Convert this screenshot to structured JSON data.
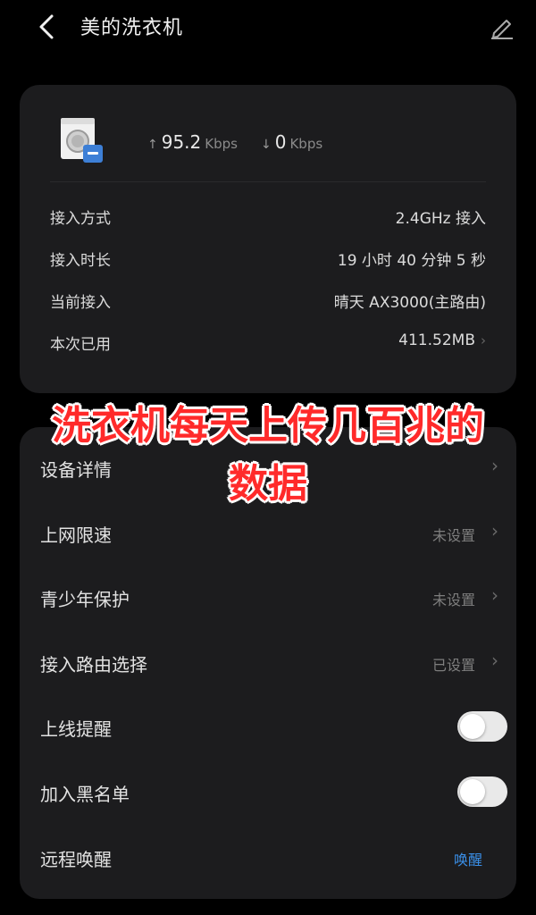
{
  "header": {
    "title": "美的洗衣机",
    "back_icon": "chevron-left-icon",
    "edit_icon": "pencil-edit-icon"
  },
  "device": {
    "icon": "washing-machine-icon",
    "upload_arrow": "↑",
    "upload_value": "95.2",
    "upload_unit": "Kbps",
    "download_arrow": "↓",
    "download_value": "0",
    "download_unit": "Kbps"
  },
  "info": [
    {
      "label": "接入方式",
      "value": "2.4GHz 接入"
    },
    {
      "label": "接入时长",
      "value": "19 小时 40 分钟 5 秒"
    },
    {
      "label": "当前接入",
      "value": "晴天 AX3000(主路由)"
    },
    {
      "label": "本次已用",
      "value": "411.52MB",
      "chevron": "›"
    }
  ],
  "settings": [
    {
      "label": "设备详情",
      "value": "",
      "chevron": "›"
    },
    {
      "label": "上网限速",
      "value": "未设置",
      "chevron": "›"
    },
    {
      "label": "青少年保护",
      "value": "未设置",
      "chevron": "›"
    },
    {
      "label": "接入路由选择",
      "value": "已设置",
      "chevron": "›"
    },
    {
      "label": "上线提醒",
      "toggle_on": false
    },
    {
      "label": "加入黑名单",
      "toggle_on": false
    },
    {
      "label": "远程唤醒",
      "action": "唤醒"
    }
  ],
  "overlay": {
    "line1": "洗衣机每天上传几百兆的",
    "line2": "数据"
  },
  "colors": {
    "background": "#000000",
    "card": "#1c1c1e",
    "overlay_text": "#ff2a2a",
    "link": "#3a8ee6"
  }
}
